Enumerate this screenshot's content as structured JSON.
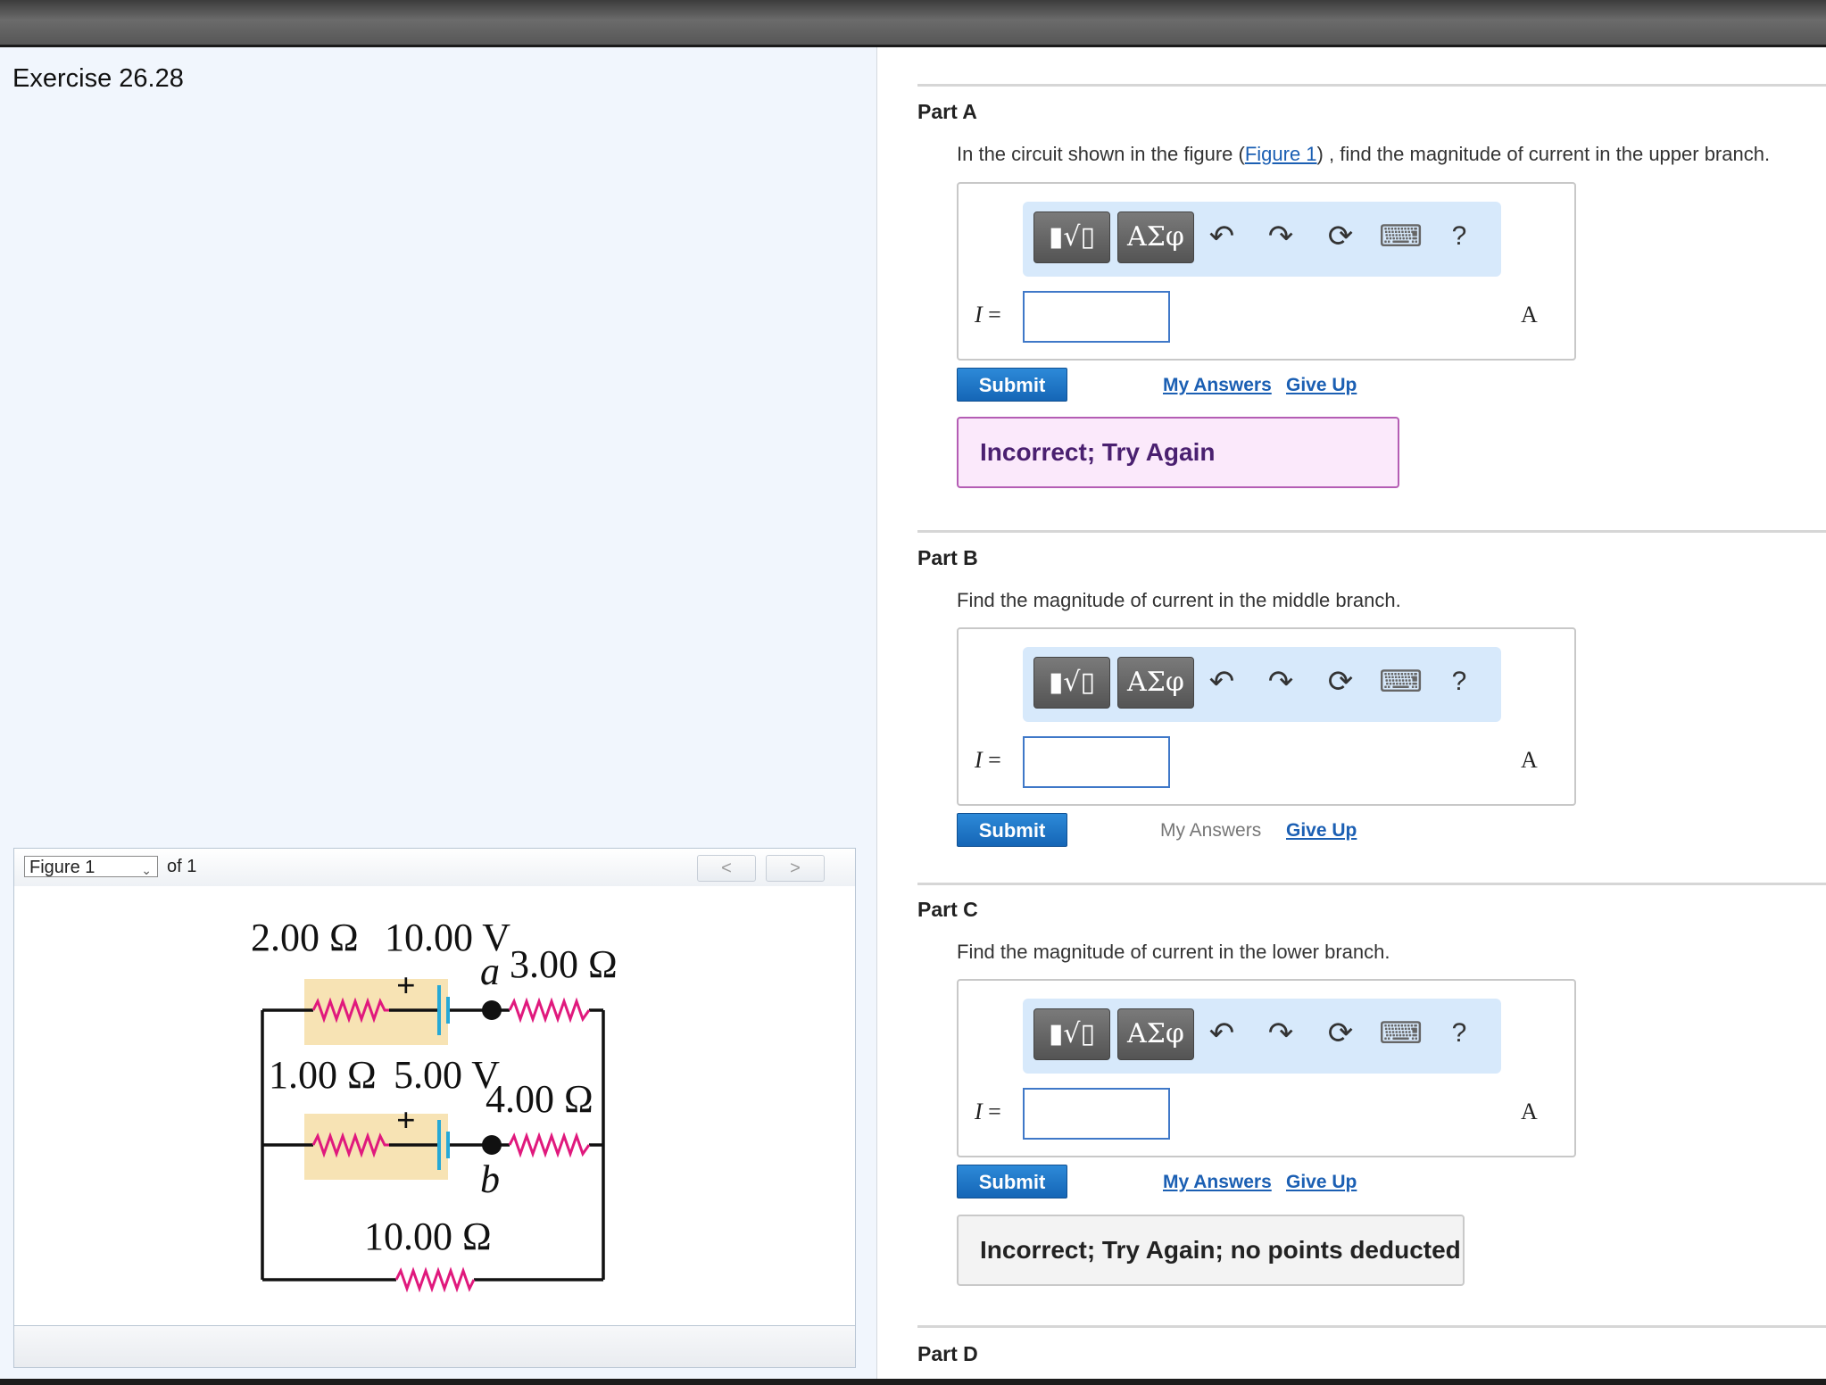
{
  "exercise": {
    "title": "Exercise 26.28"
  },
  "figure": {
    "selected": "Figure 1",
    "of_text": "of 1",
    "prev": "<",
    "next": ">",
    "labels": {
      "r_top_left": "2.00 Ω",
      "v_top": "10.00 V",
      "node_a": "a",
      "r_top_right": "3.00 Ω",
      "r_mid_left": "1.00 Ω",
      "v_mid": "5.00 V",
      "r_mid_right": "4.00 Ω",
      "node_b": "b",
      "r_bottom": "10.00 Ω",
      "plus": "+"
    }
  },
  "toolbar": {
    "templates": "▮√▯",
    "symbols": "ΑΣφ",
    "undo": "↶",
    "redo": "↷",
    "reset": "⟳",
    "keyboard": "⌨",
    "help": "?"
  },
  "parts": [
    {
      "title": "Part A",
      "prompt_pre": "In the circuit shown in the figure (",
      "prompt_link": "Figure 1",
      "prompt_post": ") , find the magnitude of current in the upper branch.",
      "var": "I",
      "eq": " =",
      "unit": "A",
      "value": "",
      "submit": "Submit",
      "my_answers": "My Answers",
      "give_up": "Give Up",
      "feedback": "Incorrect; Try Again"
    },
    {
      "title": "Part B",
      "prompt": "Find the magnitude of current in the middle branch.",
      "var": "I",
      "eq": " =",
      "unit": "A",
      "value": "",
      "submit": "Submit",
      "my_answers": "My Answers",
      "give_up": "Give Up"
    },
    {
      "title": "Part C",
      "prompt": "Find the magnitude of current in the lower branch.",
      "var": "I",
      "eq": " =",
      "unit": "A",
      "value": "",
      "submit": "Submit",
      "my_answers": "My Answers",
      "give_up": "Give Up",
      "feedback": "Incorrect; Try Again; no points deducted"
    },
    {
      "title": "Part D"
    }
  ],
  "colors": {
    "resistor": "#e0197d",
    "battery": "#27a9d6",
    "highlight": "#f7e3b4",
    "link": "#1b5fb3",
    "submit": "#1d74c6"
  }
}
